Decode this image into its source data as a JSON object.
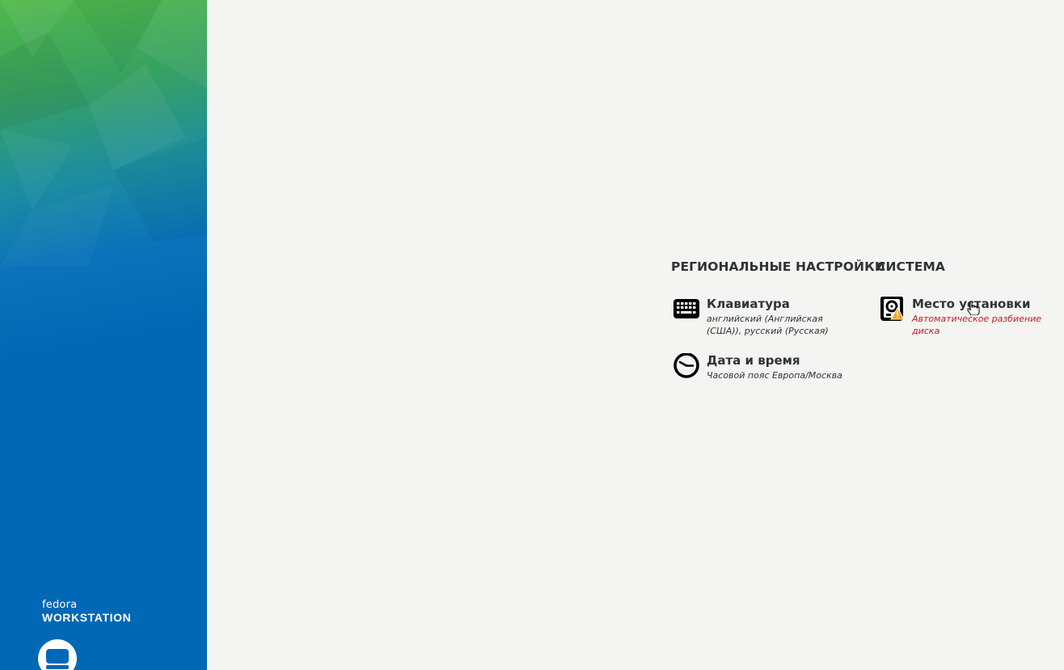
{
  "brand": {
    "distro": "fedora",
    "edition": "WORKSTATION",
    "icon": "workstation-logo-icon"
  },
  "colors": {
    "sidebar_top": "#51b84a",
    "sidebar_bottom": "#0068b4",
    "background": "#f4f4f2",
    "text": "#2e3436",
    "warning_text": "#c01c28",
    "warning_badge": "#f6a21d"
  },
  "sections": {
    "localization": {
      "title": "РЕГИОНАЛЬНЫЕ НАСТРОЙКИ",
      "spokes": [
        {
          "title": "Клавиатура",
          "status_line1": "английский (Английская",
          "status_line2": "(США)), русский (Русская)",
          "icon": "keyboard-icon"
        },
        {
          "title": "Дата и время",
          "status_line1": "Часовой пояс Европа/Москва",
          "icon": "clock-icon"
        }
      ]
    },
    "system": {
      "title": "СИСТЕМА",
      "spokes": [
        {
          "title": "Место установки",
          "status_line1": "Автоматическое разбиение",
          "status_line2": "диска",
          "icon": "harddisk-warning-icon"
        }
      ]
    }
  }
}
